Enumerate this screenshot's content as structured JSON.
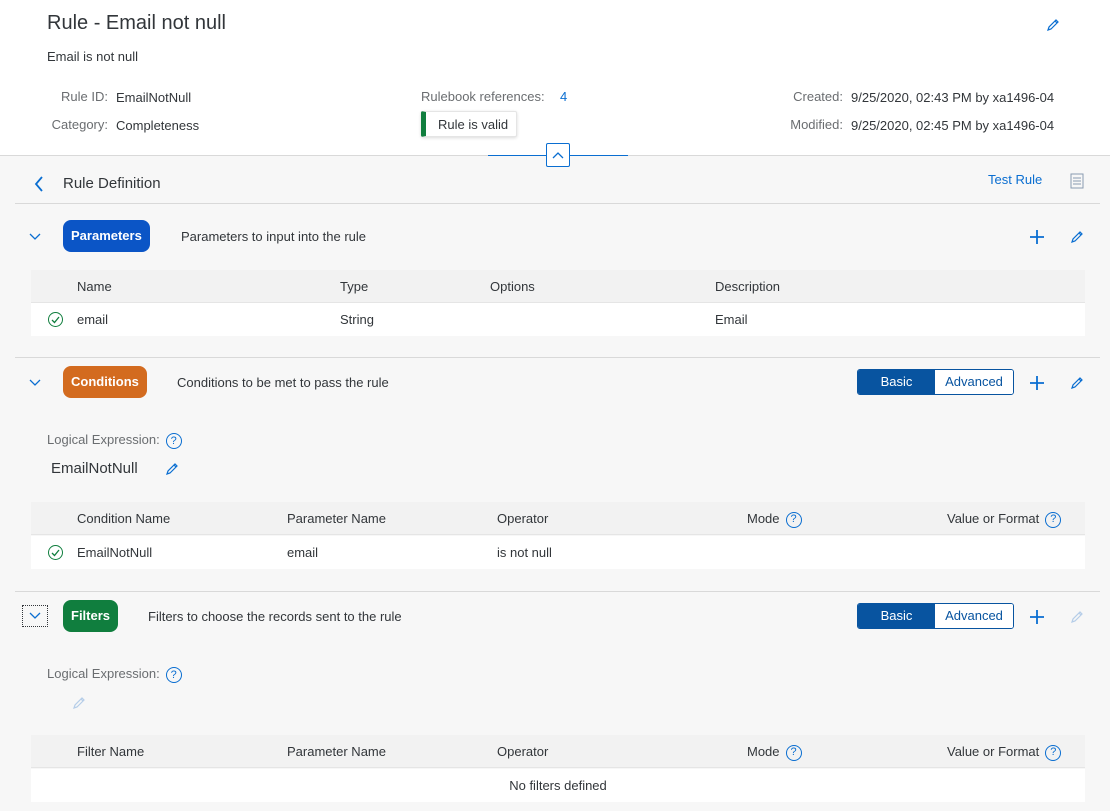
{
  "header": {
    "title": "Rule - Email not null",
    "description": "Email is not null",
    "rule_id_label": "Rule ID:",
    "rule_id": "EmailNotNull",
    "category_label": "Category:",
    "category": "Completeness",
    "rulebook_refs_label": "Rulebook references:",
    "rulebook_refs": "4",
    "valid_status": "Rule is valid",
    "created_label": "Created:",
    "created": "9/25/2020, 02:43 PM by xa1496-04",
    "modified_label": "Modified:",
    "modified": "9/25/2020, 02:45 PM by xa1496-04"
  },
  "definition": {
    "title": "Rule Definition",
    "test_rule": "Test Rule"
  },
  "parameters": {
    "badge": "Parameters",
    "badge_color": "#0b55c6",
    "description": "Parameters to input into the rule",
    "columns": [
      "Name",
      "Type",
      "Options",
      "Description"
    ],
    "rows": [
      {
        "name": "email",
        "type": "String",
        "options": "",
        "description": "Email"
      }
    ]
  },
  "conditions": {
    "badge": "Conditions",
    "badge_color": "#d36b1f",
    "description": "Conditions to be met to pass the rule",
    "seg_basic": "Basic",
    "seg_advanced": "Advanced",
    "logical_expression_label": "Logical Expression:",
    "logical_expression": "EmailNotNull",
    "columns": [
      "Condition Name",
      "Parameter Name",
      "Operator",
      "Mode",
      "Value or Format"
    ],
    "rows": [
      {
        "name": "EmailNotNull",
        "parameter": "email",
        "operator": "is not null",
        "mode": "",
        "value": ""
      }
    ]
  },
  "filters": {
    "badge": "Filters",
    "badge_color": "#107e3e",
    "description": "Filters to choose the records sent to the rule",
    "seg_basic": "Basic",
    "seg_advanced": "Advanced",
    "logical_expression_label": "Logical Expression:",
    "columns": [
      "Filter Name",
      "Parameter Name",
      "Operator",
      "Mode",
      "Value or Format"
    ],
    "empty_text": "No filters defined"
  },
  "icons": {
    "help_glyph": "?"
  }
}
